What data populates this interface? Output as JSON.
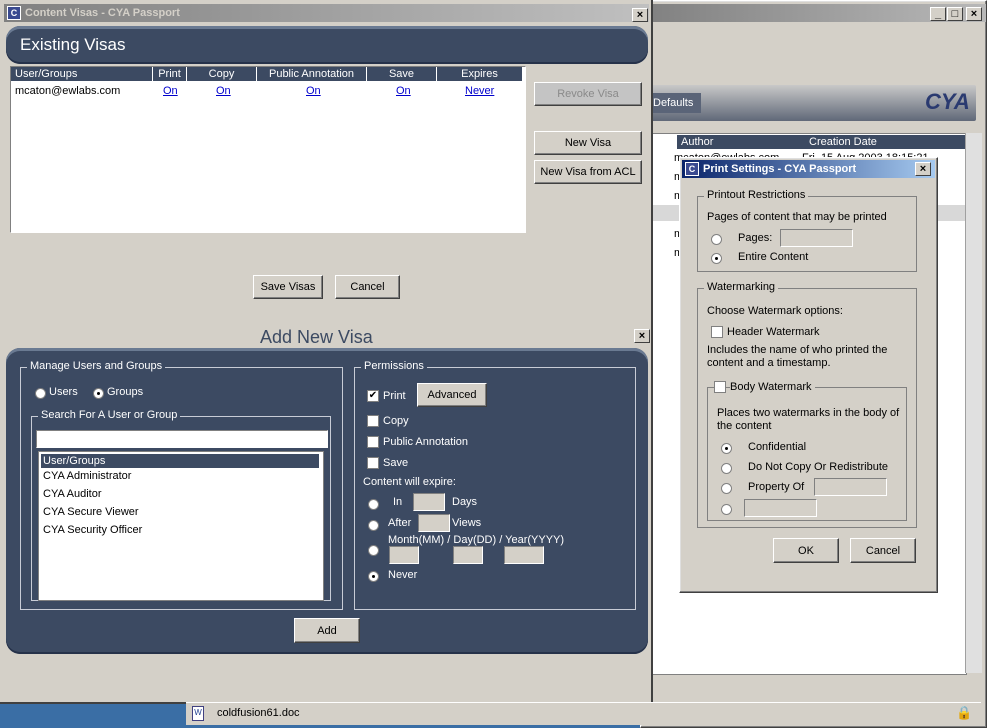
{
  "background_window": {
    "minimize": "_",
    "maximize": "□",
    "close": "×",
    "defaults_tab": "Defaults",
    "brand": "CYA",
    "columns": [
      "Author",
      "Creation Date"
    ],
    "rows": [
      {
        "author": "mcaton@ewlabs.com",
        "date": "Fri, 15 Aug 2003 18:15:21"
      },
      {
        "author": "m",
        "date": ""
      },
      {
        "author": "m",
        "date": ""
      },
      {
        "author": "m",
        "date": ""
      },
      {
        "author": "m",
        "date": ""
      },
      {
        "author": "m",
        "date": ""
      }
    ]
  },
  "main_window": {
    "title": "Content Visas - CYA Passport",
    "close": "×",
    "existing_header": "Existing Visas",
    "table": {
      "columns": [
        "User/Groups",
        "Print",
        "Copy",
        "Public Annotation",
        "Save",
        "Expires"
      ],
      "rows": [
        {
          "user": "mcaton@ewlabs.com",
          "print": "On",
          "copy": "On",
          "annotation": "On",
          "save": "On",
          "expires": "Never"
        }
      ]
    },
    "buttons": {
      "revoke": "Revoke Visa",
      "new_visa": "New Visa",
      "new_from_acl": "New Visa from ACL",
      "save_visas": "Save Visas",
      "cancel": "Cancel",
      "add": "Add"
    },
    "add_new_title": "Add New Visa",
    "close2": "×",
    "manage": {
      "legend": "Manage Users and Groups",
      "users": "Users",
      "groups": "Groups",
      "search_legend": "Search For A User or Group",
      "search_value": "",
      "list": [
        "User/Groups",
        "CYA Administrator",
        "CYA Auditor",
        "CYA Secure Viewer",
        "CYA Security Officer"
      ]
    },
    "permissions": {
      "legend": "Permissions",
      "print": "Print",
      "advanced": "Advanced",
      "copy": "Copy",
      "public_annotation": "Public Annotation",
      "save": "Save",
      "expire_label": "Content will expire:",
      "in": "In",
      "days": "Days",
      "after": "After",
      "views": "Views",
      "date_label": "Month(MM) / Day(DD) / Year(YYYY)",
      "never": "Never"
    }
  },
  "print_dialog": {
    "title": "Print Settings - CYA Passport",
    "close": "×",
    "restrictions_legend": "Printout Restrictions",
    "pages_label": "Pages of content that may be printed",
    "pages": "Pages:",
    "entire": "Entire Content",
    "watermark_legend": "Watermarking",
    "choose": "Choose Watermark options:",
    "header_wm": "Header Watermark",
    "header_desc": "Includes the name of who printed the content and a timestamp.",
    "body_wm": "Body Watermark",
    "body_desc": "Places two watermarks in the body of the content",
    "confidential": "Confidential",
    "do_not_copy": "Do Not Copy Or Redistribute",
    "property_of": "Property Of",
    "ok": "OK",
    "cancel": "Cancel"
  },
  "taskbar": {
    "file": "coldfusion61.doc"
  }
}
